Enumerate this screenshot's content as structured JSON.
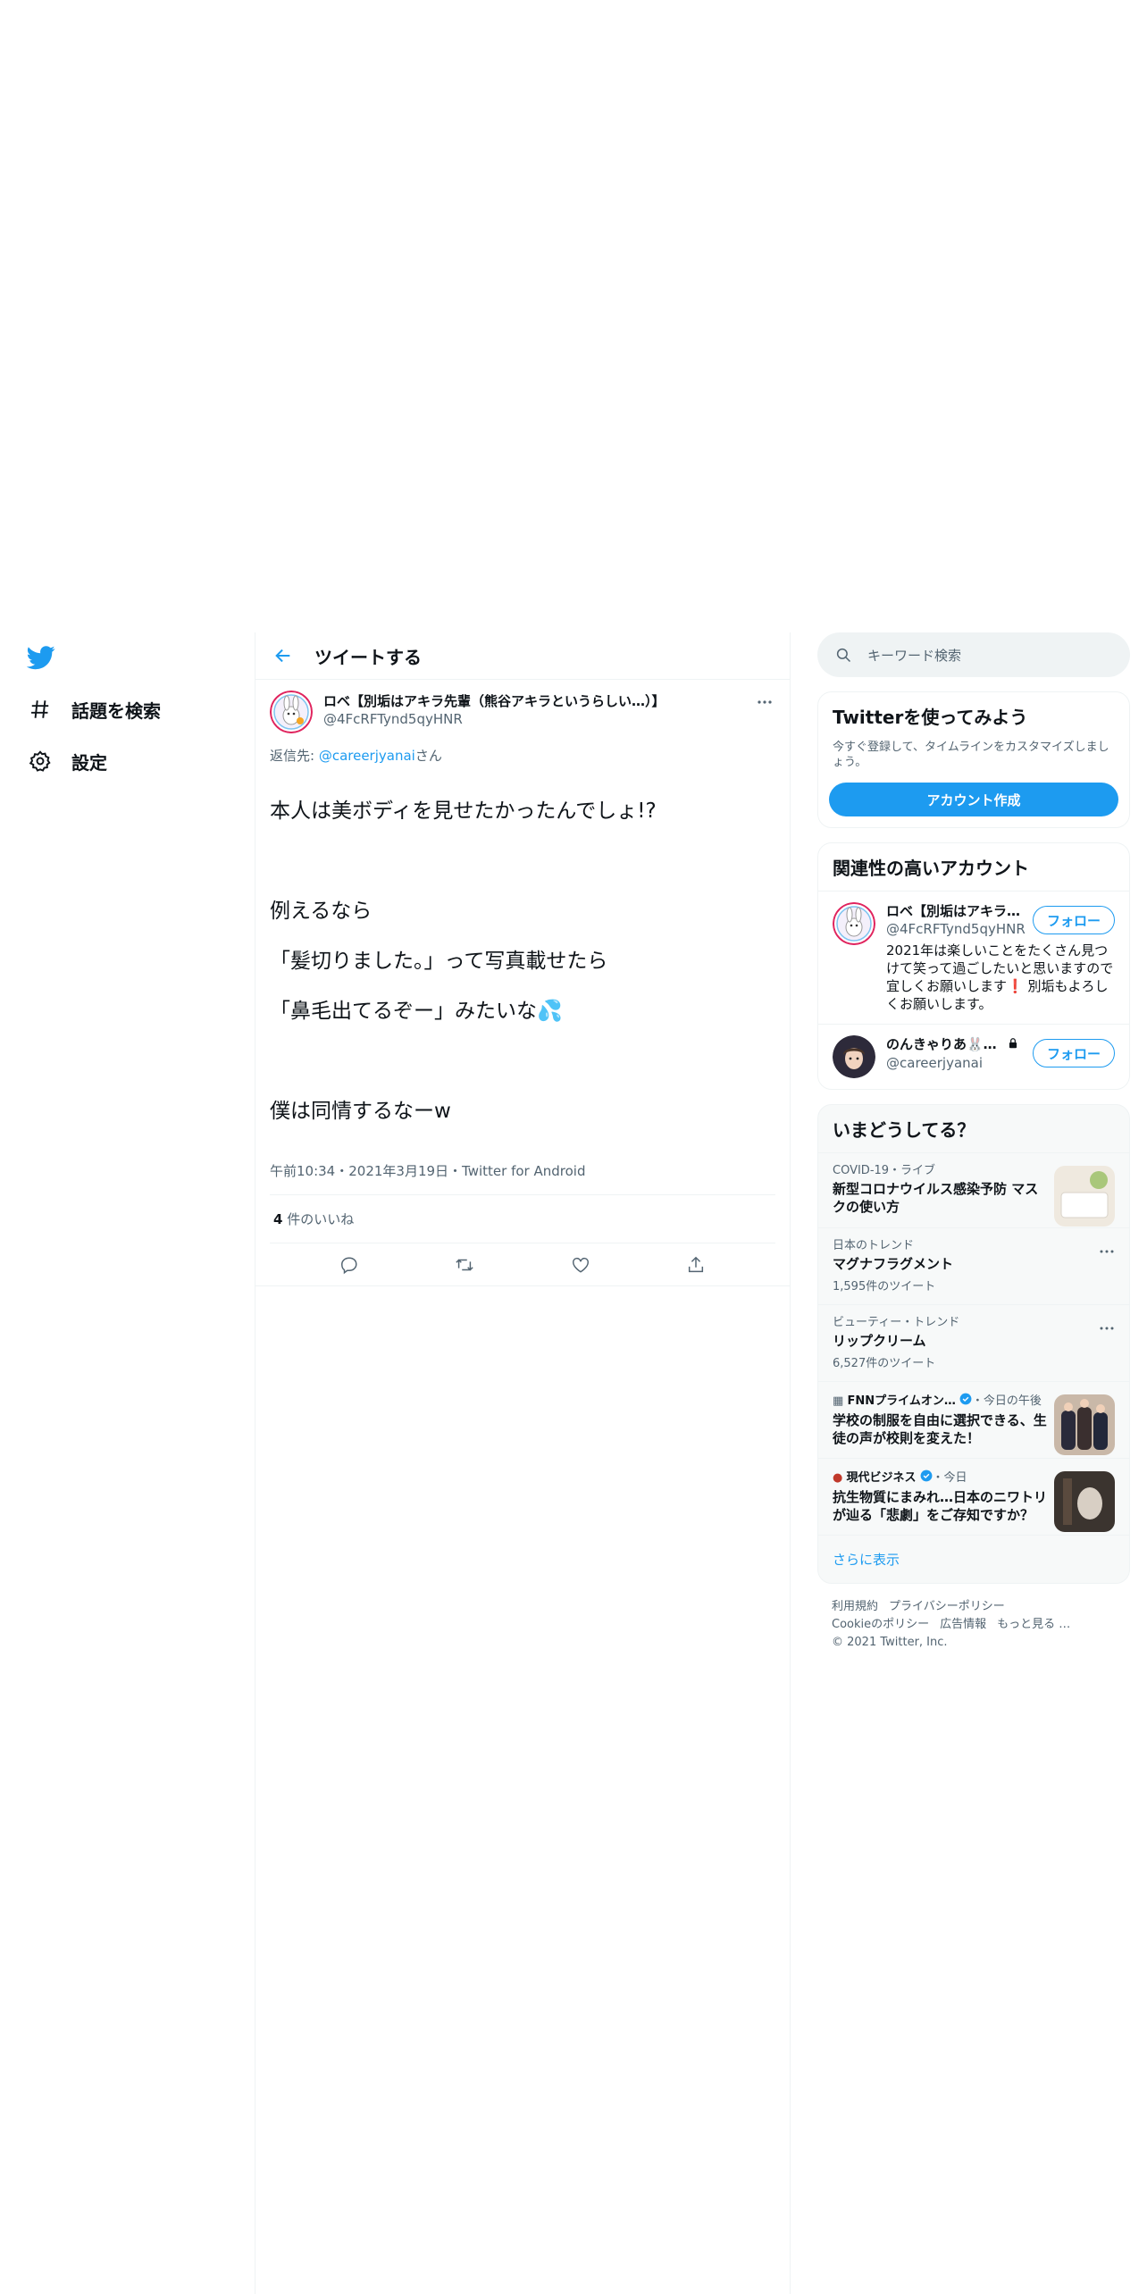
{
  "nav": {
    "logo": "twitter-bird-icon",
    "items": [
      {
        "label": "話題を検索",
        "icon": "hashtag-icon"
      },
      {
        "label": "設定",
        "icon": "gear-icon"
      }
    ]
  },
  "header": {
    "title": "ツイートする"
  },
  "tweet": {
    "name": "ロベ【別垢はアキラ先輩（熊谷アキラというらしい…）】",
    "handle": "@4FcRFTynd5qyHNR",
    "reply_prefix": "返信先: ",
    "reply_to": "@careerjyanai",
    "reply_suffix": "さん",
    "text_lines": [
      "本人は美ボディを見せたかったんでしょ!?",
      "",
      "例えるなら",
      "「髪切りました。」って写真載せたら",
      "「鼻毛出てるぞー」みたいな💦",
      "",
      "僕は同情するなーw"
    ],
    "meta": "午前10:34・2021年3月19日・Twitter for Android",
    "likes_count": "4",
    "likes_label": " 件のいいね"
  },
  "right": {
    "search_placeholder": "キーワード検索",
    "signup": {
      "title": "Twitterを使ってみよう",
      "desc": "今すぐ登録して、タイムラインをカスタマイズしましょう。",
      "button": "アカウント作成"
    },
    "related": {
      "title": "関連性の高いアカウント",
      "accounts": [
        {
          "name": "ロベ【別垢はアキラ…",
          "handle": "@4FcRFTynd5qyHNR",
          "bio": "2021年は楽しいことをたくさん見つけて笑って過ごしたいと思いますので宜しくお願いします❗ 別垢もよろしくお願いします。",
          "follow": "フォロー"
        },
        {
          "name": "のんきゃりあ🐰…",
          "handle": "@careerjyanai",
          "bio": "",
          "follow": "フォロー"
        }
      ]
    },
    "trends": {
      "title": "いまどうしてる？",
      "items": [
        {
          "meta": "COVID-19・ライブ",
          "title": "新型コロナウイルス感染予防 マスクの使い方",
          "count": ""
        },
        {
          "meta": "日本のトレンド",
          "title": "マグナフラグメント",
          "count": "1,595件のツイート"
        },
        {
          "meta": "ビューティー・トレンド",
          "title": "リップクリーム",
          "count": "6,527件のツイート"
        },
        {
          "meta_source": "FNNプライムオン…",
          "meta_time": "・今日の午後",
          "title": "学校の制服を自由に選択できる、生徒の声が校則を変えた！",
          "count": ""
        },
        {
          "meta_source": "現代ビジネス",
          "meta_time": "・今日",
          "title": "抗生物質にまみれ…日本のニワトリが辿る「悲劇」をご存知ですか？",
          "count": ""
        }
      ],
      "show_more": "さらに表示"
    },
    "footer": {
      "links1": [
        "利用規約",
        "プライバシーポリシー"
      ],
      "links2": [
        "Cookieのポリシー",
        "広告情報",
        "もっと見る …"
      ],
      "copyright": "© 2021 Twitter, Inc."
    }
  },
  "colors": {
    "accent": "#1d9bf0",
    "muted": "#536471",
    "border": "#eff3f4"
  }
}
